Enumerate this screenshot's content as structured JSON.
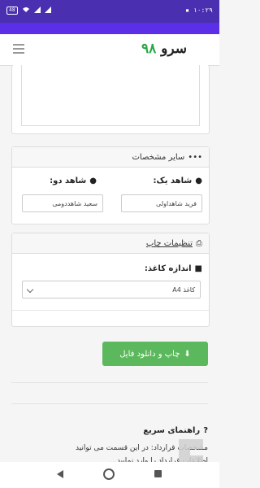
{
  "status_bar": {
    "time": "۱۰:۲۹",
    "battery": "48"
  },
  "app": {
    "logo_text": "سرو",
    "logo_number": "۹۸"
  },
  "other_details": {
    "header": "سایر مشخصات",
    "witness1_label": "شاهد یک:",
    "witness1_value": "فرید شاهداولی",
    "witness2_label": "شاهد دو:",
    "witness2_value": "سعید شاهددومی"
  },
  "print_settings": {
    "header": "تنظیمات چاپ",
    "paper_size_label": "اندازه کاغذ:",
    "paper_size_value": "کاغذ A4"
  },
  "print_button_label": "چاپ و دانلود فایل",
  "quick_help": {
    "title": "راهنمای سریع",
    "line1": "مشخصات قرارداد: در این قسمت می توانید",
    "line2": "اطلاعات قرارداد را وارد نمایید..."
  },
  "colors": {
    "status_bar": "#4a2fb0",
    "accent_purple": "#5b2ee8",
    "button_green": "#5cb85c",
    "logo_green": "#27a844"
  }
}
